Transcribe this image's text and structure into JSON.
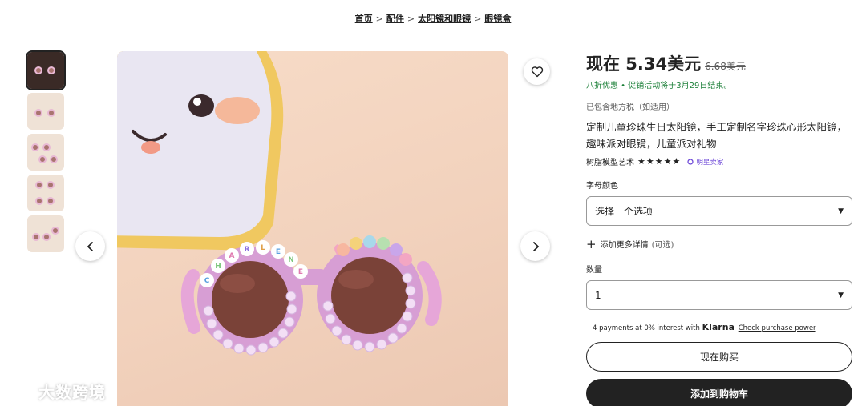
{
  "breadcrumb": {
    "items": [
      "首页",
      "配件",
      "太阳镜和眼镜",
      "眼镜盒"
    ],
    "separator": ">"
  },
  "gallery": {
    "thumb_count": 5,
    "active_index": 0,
    "bead_text": "CHARLENE"
  },
  "watermark": {
    "text": "大数跨境"
  },
  "price": {
    "current": "现在 5.34美元",
    "original": "6.68美元",
    "promo": "八折优惠 • 促销活动将于3月29日结束。",
    "tax_note": "已包含地方税（如适用）"
  },
  "product": {
    "title": "定制儿童珍珠生日太阳镜，手工定制名字珍珠心形太阳镜，趣味派对眼镜，儿童派对礼物",
    "seller": "树脂模型艺术",
    "stars": "★★★★★",
    "badge": "明星卖家"
  },
  "options": {
    "color_label": "字母颜色",
    "color_placeholder": "选择一个选项",
    "add_details": "添加更多详情",
    "add_details_optional": "(可选)",
    "quantity_label": "数量",
    "quantity_value": "1"
  },
  "klarna": {
    "prefix": "4 payments at 0% interest with",
    "brand": "Klarna",
    "link": "Check purchase power"
  },
  "buttons": {
    "buy_now": "现在购买",
    "add_to_cart": "添加到购物车"
  },
  "colors": {
    "accent_green": "#1a7f37",
    "badge_purple": "#6f4ad8",
    "primary_dark": "#222222"
  }
}
